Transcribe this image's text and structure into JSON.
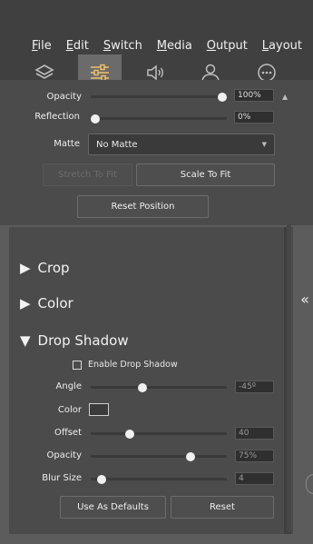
{
  "menu": {
    "items": [
      {
        "first": "F",
        "rest": "ile"
      },
      {
        "first": "E",
        "rest": "dit"
      },
      {
        "first": "S",
        "rest": "witch"
      },
      {
        "first": "M",
        "rest": "edia"
      },
      {
        "first": "O",
        "rest": "utput"
      },
      {
        "first": "L",
        "rest": "ayout"
      }
    ]
  },
  "tabs": [
    {
      "icon": "layers-icon"
    },
    {
      "icon": "sliders-icon",
      "active": true
    },
    {
      "icon": "speaker-icon"
    },
    {
      "icon": "user-icon"
    },
    {
      "icon": "more-icon"
    }
  ],
  "upper": {
    "opacity_label": "Opacity",
    "opacity_value": "100%",
    "opacity_level": 1.0,
    "reflection_label": "Reflection",
    "reflection_value": "0%",
    "reflection_level": 0.0,
    "matte_label": "Matte",
    "matte_value": "No Matte",
    "stretch_label": "Stretch To Fit",
    "scale_label": "Scale To Fit",
    "reset_position_label": "Reset Position"
  },
  "sections": {
    "crop": "Crop",
    "color": "Color",
    "drop_shadow": "Drop Shadow"
  },
  "drop_shadow": {
    "enable_label": "Enable Drop Shadow",
    "angle_label": "Angle",
    "angle_value": "-45º",
    "angle_level": 0.37,
    "color_label": "Color",
    "offset_label": "Offset",
    "offset_value": "40",
    "offset_level": 0.27,
    "opacity_label": "Opacity",
    "opacity_value": "75%",
    "opacity_level": 0.75,
    "blur_label": "Blur Size",
    "blur_value": "4",
    "blur_level": 0.05,
    "defaults_label": "Use As Defaults",
    "reset_label": "Reset"
  },
  "colors": {
    "accent": "#f2c26b",
    "panel": "#4b4b4b",
    "background": "#5c5c5c"
  }
}
